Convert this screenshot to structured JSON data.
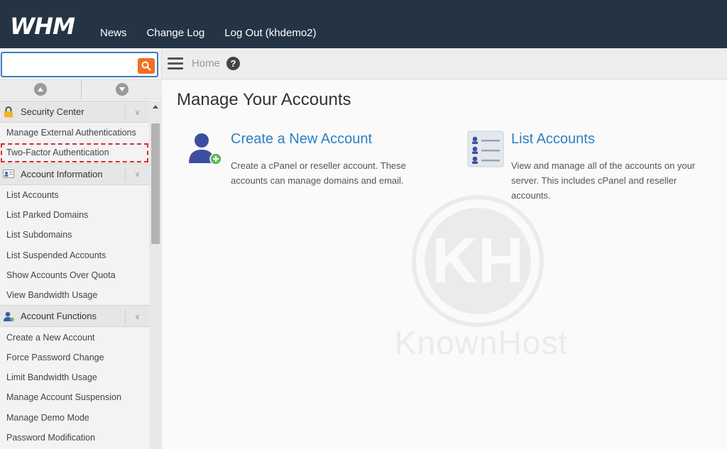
{
  "header": {
    "logo": "WHM",
    "nav": [
      {
        "label": "News"
      },
      {
        "label": "Change Log"
      },
      {
        "label": "Log Out (khdemo2)"
      }
    ]
  },
  "sidebar": {
    "search": {
      "value": "",
      "placeholder": ""
    },
    "sections": [
      {
        "label": "Security Center",
        "icon": "lock-icon",
        "items": [
          "Manage External Authentications",
          "Two-Factor Authentication"
        ]
      },
      {
        "label": "Account Information",
        "icon": "account-info-icon",
        "items": [
          "List Accounts",
          "List Parked Domains",
          "List Subdomains",
          "List Suspended Accounts",
          "Show Accounts Over Quota",
          "View Bandwidth Usage"
        ]
      },
      {
        "label": "Account Functions",
        "icon": "user-icon",
        "items": [
          "Create a New Account",
          "Force Password Change",
          "Limit Bandwidth Usage",
          "Manage Account Suspension",
          "Manage Demo Mode",
          "Password Modification"
        ]
      }
    ],
    "highlighted_item": "Two-Factor Authentication"
  },
  "breadcrumb": {
    "home": "Home"
  },
  "main": {
    "title": "Manage Your Accounts",
    "cards": [
      {
        "title": "Create a New Account",
        "desc_line1": "Create a cPanel or reseller account. These",
        "desc_line2": "accounts can manage domains and email.",
        "icon": "add-user-icon"
      },
      {
        "title": "List Accounts",
        "desc_line1": "View and manage all of the accounts on your",
        "desc_line2": "server. This includes cPanel and reseller",
        "desc_line3": "accounts.",
        "icon": "list-accounts-icon"
      }
    ]
  },
  "watermark": {
    "text": "KnownHost"
  },
  "colors": {
    "topbar": "#243444",
    "link": "#2f7fc1",
    "search_button": "#f36f21",
    "highlight": "#d92b2b"
  }
}
